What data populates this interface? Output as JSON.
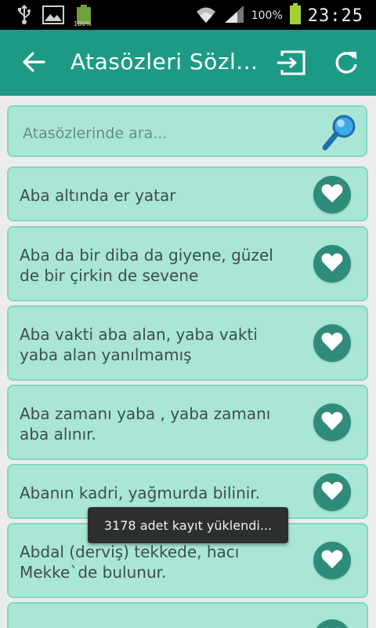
{
  "statusbar": {
    "battery_small_label": "100%",
    "battery_percent": "100%",
    "time": "23:25"
  },
  "appbar": {
    "title": "Atasözleri Sözl...",
    "accent": "#1d9a86"
  },
  "search": {
    "placeholder": "Atasözlerinde ara..."
  },
  "items": [
    {
      "text": "Aba altında er yatar"
    },
    {
      "text": "Aba da bir diba da giyene, güzel de bir çirkin de sevene"
    },
    {
      "text": "Aba vakti aba alan, yaba vakti yaba alan yanılmamış"
    },
    {
      "text": "Aba zamanı yaba , yaba zamanı aba alınır."
    },
    {
      "text": "Abanın kadri, yağmurda bilinir."
    },
    {
      "text": "Abdal (derviş) tekkede, hacı Mekke`de bulunur."
    }
  ],
  "toast": {
    "text": "3178 adet kayıt yüklendi..."
  }
}
